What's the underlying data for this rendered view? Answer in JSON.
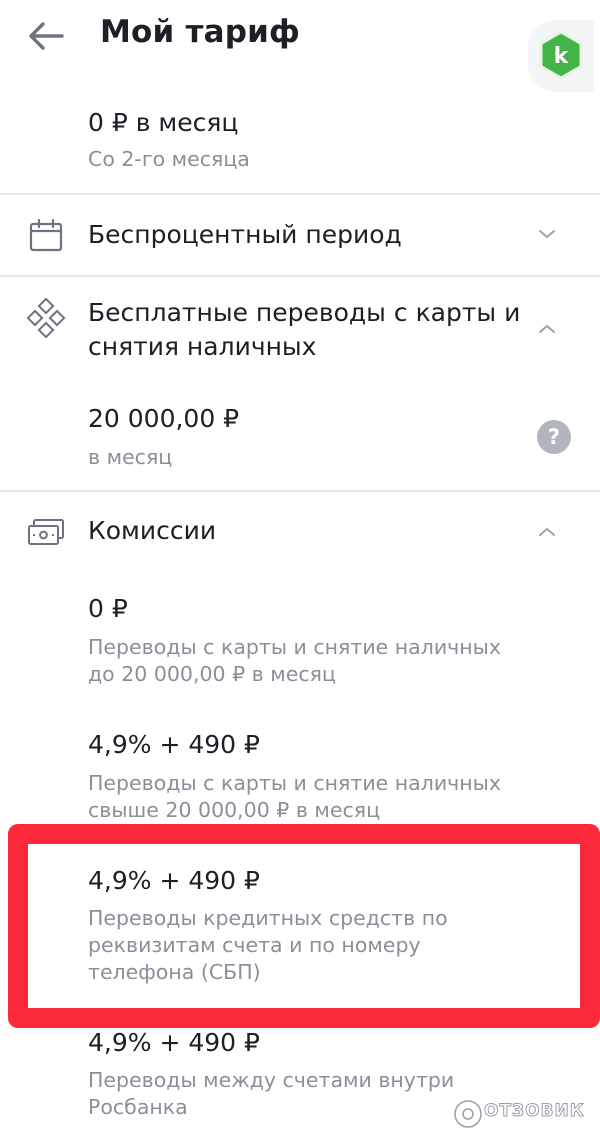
{
  "header": {
    "title": "Мой тариф",
    "back_icon": "arrow-left-icon",
    "logo_letter": "k",
    "logo_color": "#4caf50"
  },
  "monthly_fee": {
    "value": "0 ₽ в месяц",
    "note": "Со 2-го месяца"
  },
  "sections": {
    "interest_free": {
      "title": "Беспроцентный период",
      "icon": "calendar-icon",
      "expanded": false
    },
    "free_transfers": {
      "title_line1": "Бесплатные переводы с карты и",
      "title_line2": "снятия наличных",
      "icon": "diamond-grid-icon",
      "expanded": true,
      "amount": "20 000,00 ₽",
      "period": "в месяц",
      "help_label": "?"
    },
    "commissions": {
      "title": "Комиссии",
      "icon": "cash-icon",
      "expanded": true,
      "items": [
        {
          "value": "0 ₽",
          "desc_line1": "Переводы с карты и снятие наличных",
          "desc_line2": "до 20 000,00 ₽ в месяц"
        },
        {
          "value": "4,9% + 490 ₽",
          "desc_line1": "Переводы с карты и снятие наличных",
          "desc_line2": "свыше 20 000,00 ₽ в месяц"
        },
        {
          "value": "4,9% + 490 ₽",
          "desc_line1": "Переводы кредитных средств по",
          "desc_line2": "реквизитам счета и по номеру",
          "desc_line3": "телефона (СБП)"
        },
        {
          "value": "4,9% + 490 ₽",
          "desc_line1": "Переводы между счетами внутри",
          "desc_line2": "Росбанка"
        }
      ]
    }
  },
  "highlight_color": "#fb2a3a",
  "watermark": {
    "text": "ОТЗОВИК",
    "icon": "otzovik-logo-icon"
  }
}
